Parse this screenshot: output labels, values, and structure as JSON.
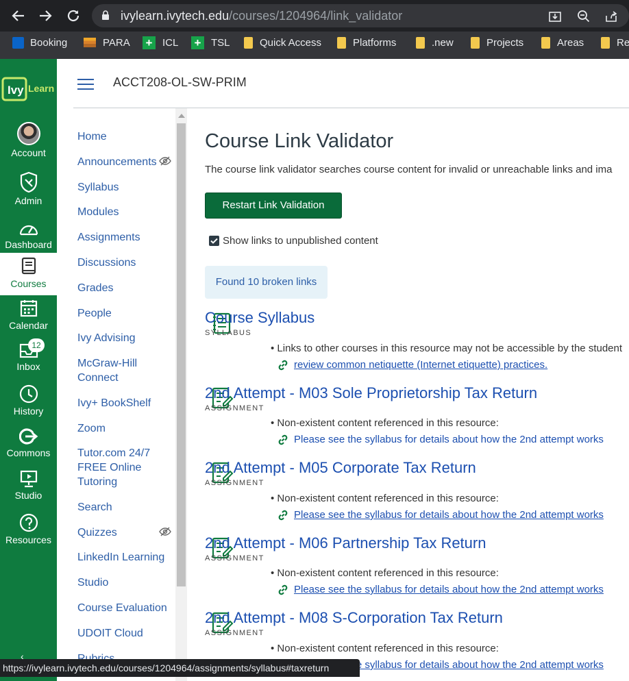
{
  "browser": {
    "url_host": "ivylearn.ivytech.edu",
    "url_path": "/courses/1204964/link_validator",
    "bookmarks": [
      {
        "label": "Booking",
        "icon": "outlook-icon"
      },
      {
        "label": "PARA",
        "icon": "layers-icon"
      },
      {
        "label": "ICL",
        "icon": "green-cross-icon"
      },
      {
        "label": "TSL",
        "icon": "green-cross-icon"
      },
      {
        "label": "Quick Access",
        "icon": "folder-icon"
      },
      {
        "label": "Platforms",
        "icon": "folder-icon"
      },
      {
        "label": ".new",
        "icon": "folder-icon"
      },
      {
        "label": "Projects",
        "icon": "folder-icon"
      },
      {
        "label": "Areas",
        "icon": "folder-icon"
      },
      {
        "label": "Re",
        "icon": "folder-icon"
      }
    ]
  },
  "rail": {
    "logo": "Ivy Learn",
    "badge": "12",
    "items": [
      {
        "label": "Account",
        "icon": "avatar-icon"
      },
      {
        "label": "Admin",
        "icon": "shield-icon"
      },
      {
        "label": "Dashboard",
        "icon": "speedometer-icon"
      },
      {
        "label": "Courses",
        "icon": "book-icon"
      },
      {
        "label": "Calendar",
        "icon": "calendar-icon"
      },
      {
        "label": "Inbox",
        "icon": "inbox-icon"
      },
      {
        "label": "History",
        "icon": "clock-icon"
      },
      {
        "label": "Commons",
        "icon": "arrow-in-circle-icon"
      },
      {
        "label": "Studio",
        "icon": "presentation-icon"
      },
      {
        "label": "Resources",
        "icon": "help-circle-icon"
      }
    ]
  },
  "course": {
    "breadcrumb": "ACCT208-OL-SW-PRIM"
  },
  "course_nav": [
    "Home",
    "Announcements",
    "Syllabus",
    "Modules",
    "Assignments",
    "Discussions",
    "Grades",
    "People",
    "Ivy Advising",
    "McGraw-Hill Connect",
    "Ivy+ BookShelf",
    "Zoom",
    "Tutor.com 24/7 FREE Online Tutoring",
    "Search",
    "Quizzes",
    "LinkedIn Learning",
    "Studio",
    "Course Evaluation",
    "UDOIT Cloud",
    "Rubrics"
  ],
  "page": {
    "title": "Course Link Validator",
    "description": "The course link validator searches course content for invalid or unreachable links and ima",
    "restart_button": "Restart Link Validation",
    "checkbox_label": "Show links to unpublished content",
    "checkbox_checked": true,
    "result": "Found 10 broken links"
  },
  "results": [
    {
      "title": "Course Syllabus",
      "type": "SYLLABUS",
      "issue": "Links to other courses in this resource may not be accessible by the student",
      "link": "review common netiquette (Internet etiquette) practices.",
      "underlined": true,
      "icon": "syllabus-icon"
    },
    {
      "title": "2nd Attempt - M03 Sole Proprietorship Tax Return",
      "type": "ASSIGNMENT",
      "issue": "Non-existent content referenced in this resource:",
      "link": "Please see the syllabus for details about how the 2nd attempt works",
      "underlined": false,
      "icon": "assignment-icon"
    },
    {
      "title": "2nd Attempt - M05 Corporate Tax Return",
      "type": "ASSIGNMENT",
      "issue": "Non-existent content referenced in this resource:",
      "link": "Please see the syllabus for details about how the 2nd attempt works",
      "underlined": true,
      "icon": "assignment-icon"
    },
    {
      "title": "2nd Attempt - M06 Partnership Tax Return",
      "type": "ASSIGNMENT",
      "issue": "Non-existent content referenced in this resource:",
      "link": "Please see the syllabus for details about how the 2nd attempt works",
      "underlined": true,
      "icon": "assignment-icon"
    },
    {
      "title": "2nd Attempt - M08 S-Corporation Tax Return",
      "type": "ASSIGNMENT",
      "issue": "Non-existent content referenced in this resource:",
      "link": "Please see the syllabus for details about how the 2nd attempt works",
      "underlined": true,
      "icon": "assignment-icon"
    }
  ],
  "status_bar": "https://ivylearn.ivytech.edu/courses/1204964/assignments/syllabus#taxreturn",
  "colors": {
    "brand": "#0f7b3f",
    "link": "#1c4fb0",
    "button": "#0a6b3a",
    "result_bg": "#e6f2f8"
  }
}
